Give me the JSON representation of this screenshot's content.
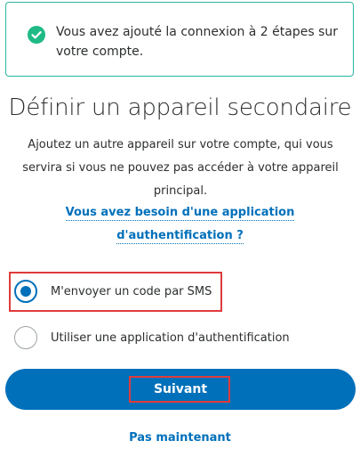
{
  "alert": {
    "icon": "check-circle-icon",
    "message": "Vous avez ajouté la connexion à 2 étapes sur votre compte.",
    "border_color": "#2cb5a0",
    "icon_color": "#1fba86"
  },
  "page": {
    "title": "Définir un appareil secondaire",
    "description": "Ajoutez un autre appareil sur votre compte, qui vous servira si vous ne pouvez pas accéder à votre appareil principal.",
    "help_link": "Vous avez besoin d'une application d'authentification ?"
  },
  "options": {
    "selected": "sms",
    "sms_label": "M'envoyer un code par SMS",
    "app_label": "Utiliser une application d'authentification"
  },
  "actions": {
    "primary_label": "Suivant",
    "secondary_label": "Pas maintenant"
  },
  "colors": {
    "accent": "#0070ba",
    "highlight": "#e03b3b",
    "text": "#2c2e2f"
  }
}
